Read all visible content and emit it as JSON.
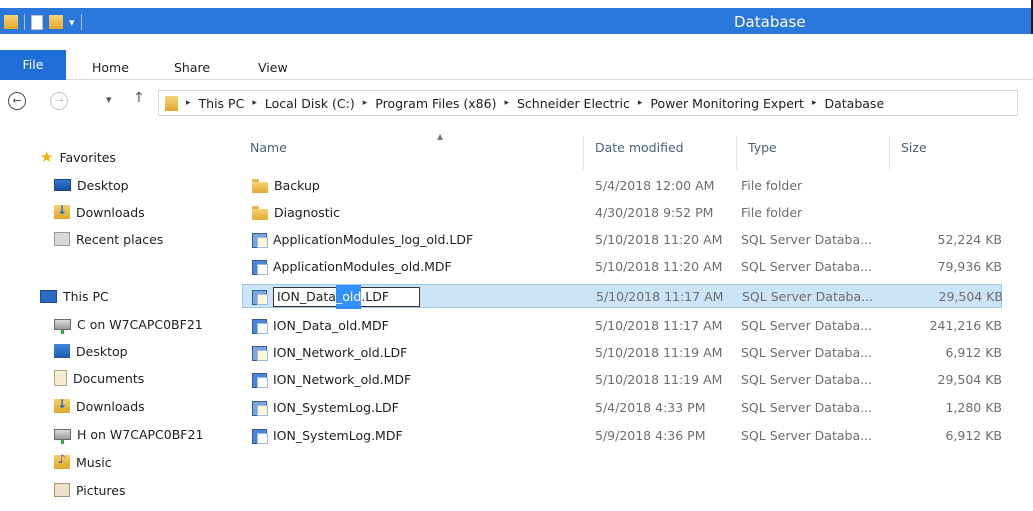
{
  "window": {
    "title": "Database"
  },
  "quick_access": {
    "dropdown_glyph": "▾"
  },
  "ribbon": {
    "tabs": [
      "File",
      "Home",
      "Share",
      "View"
    ]
  },
  "nav_buttons": {
    "back": "←",
    "forward": "→",
    "recent": "▾",
    "up": "↑"
  },
  "address": {
    "separator": "▸",
    "breadcrumbs": [
      "This PC",
      "Local Disk (C:)",
      "Program Files (x86)",
      "Schneider Electric",
      "Power Monitoring Expert",
      "Database"
    ]
  },
  "nav_pane": {
    "favorites": {
      "label": "Favorites",
      "items": [
        "Desktop",
        "Downloads",
        "Recent places"
      ]
    },
    "this_pc": {
      "label": "This PC",
      "items": [
        "C on W7CAPC0BF21",
        "Desktop",
        "Documents",
        "Downloads",
        "H on W7CAPC0BF21",
        "Music",
        "Pictures"
      ]
    }
  },
  "columns": {
    "name": "Name",
    "date": "Date modified",
    "type": "Type",
    "size": "Size",
    "sort_caret": "▲"
  },
  "files": [
    {
      "name": "Backup",
      "date": "5/4/2018 12:00 AM",
      "type": "File folder",
      "size": "",
      "icon": "folder-icon"
    },
    {
      "name": "Diagnostic",
      "date": "4/30/2018 9:52 PM",
      "type": "File folder",
      "size": "",
      "icon": "folder-icon"
    },
    {
      "name": "ApplicationModules_log_old.LDF",
      "date": "5/10/2018 11:20 AM",
      "type": "SQL Server Databa...",
      "size": "52,224 KB",
      "icon": "ldf-file-icon"
    },
    {
      "name": "ApplicationModules_old.MDF",
      "date": "5/10/2018 11:20 AM",
      "type": "SQL Server Databa...",
      "size": "79,936 KB",
      "icon": "mdf-file-icon"
    },
    {
      "name_parts": [
        "ION_Data",
        "_old",
        ".LDF"
      ],
      "date": "5/10/2018 11:17 AM",
      "type": "SQL Server Databa...",
      "size": "29,504 KB",
      "icon": "ldf-file-icon",
      "state": "renaming"
    },
    {
      "name": "ION_Data_old.MDF",
      "date": "5/10/2018 11:17 AM",
      "type": "SQL Server Databa...",
      "size": "241,216 KB",
      "icon": "mdf-file-icon"
    },
    {
      "name": "ION_Network_old.LDF",
      "date": "5/10/2018 11:19 AM",
      "type": "SQL Server Databa...",
      "size": "6,912 KB",
      "icon": "ldf-file-icon"
    },
    {
      "name": "ION_Network_old.MDF",
      "date": "5/10/2018 11:19 AM",
      "type": "SQL Server Databa...",
      "size": "29,504 KB",
      "icon": "mdf-file-icon"
    },
    {
      "name": "ION_SystemLog.LDF",
      "date": "5/4/2018 4:33 PM",
      "type": "SQL Server Databa...",
      "size": "1,280 KB",
      "icon": "ldf-file-icon"
    },
    {
      "name": "ION_SystemLog.MDF",
      "date": "5/9/2018 4:36 PM",
      "type": "SQL Server Databa...",
      "size": "6,912 KB",
      "icon": "mdf-file-icon"
    }
  ]
}
